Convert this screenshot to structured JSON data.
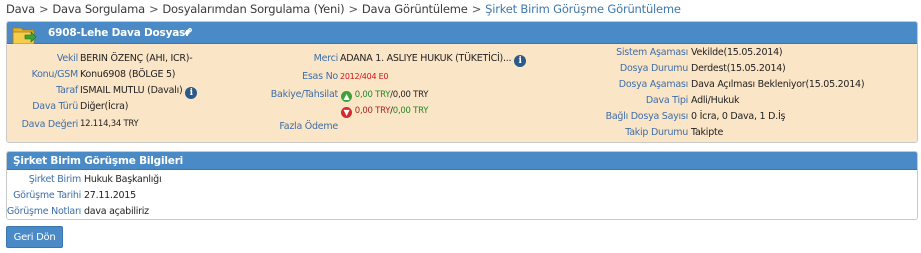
{
  "breadcrumb": {
    "items": [
      "Dava",
      "Dava Sorgulama",
      "Dosyalarımdan Sorgulama (Yeni)",
      "Dava Görüntüleme"
    ],
    "current": "Şirket Birim Görüşme Görüntüleme",
    "separator": ">"
  },
  "case_panel": {
    "title": "6908-Lehe Dava Dosyası",
    "folder_icon": "folder-arrow-icon",
    "link_icon": "link-icon",
    "fields": {
      "vekil": {
        "label": "Vekil",
        "value": "BERIN ÖZENÇ (AHI, ICR)-"
      },
      "konu_gsm": {
        "label": "Konu/GSM",
        "value": "Konu6908 (BÖLGE 5)"
      },
      "taraf": {
        "label": "Taraf",
        "value": "ISMAIL MUTLU (Davalı)"
      },
      "dava_turu": {
        "label": "Dava Türü",
        "value": "Diğer(İcra)"
      },
      "dava_degeri": {
        "label": "Dava Değeri",
        "value": "12.114,34 TRY"
      },
      "merci": {
        "label": "Merci",
        "value": "ADANA 1. ASLIYE HUKUK (TÜKETİCİ)..."
      },
      "esas_no": {
        "label": "Esas No",
        "value": "2012/404 E0"
      },
      "bakiye": {
        "label": "Bakiye/Tahsilat",
        "row1": {
          "first": "0,00 TRY",
          "second": "0,00 TRY"
        },
        "row2": {
          "first": "0,00 TRY",
          "second": "0,00 TRY"
        }
      },
      "fazla_odeme": {
        "label": "Fazla Ödeme",
        "value": ""
      },
      "sistem_asamasi": {
        "label": "Sistem Aşaması",
        "value": "Vekilde(15.05.2014)"
      },
      "dosya_durumu": {
        "label": "Dosya Durumu",
        "value": "Derdest(15.05.2014)"
      },
      "dosya_asamasi": {
        "label": "Dosya Aşaması",
        "value": "Dava Açılması Bekleniyor(15.05.2014)"
      },
      "dava_tipi": {
        "label": "Dava Tipi",
        "value": "Adli/Hukuk"
      },
      "bagli_dosya": {
        "label": "Bağlı Dosya Sayısı",
        "value": "0 İcra, 0 Dava, 1 D.İş"
      },
      "takip_durumu": {
        "label": "Takip Durumu",
        "value": "Takipte"
      }
    }
  },
  "meeting_panel": {
    "title": "Şirket Birim Görüşme Bilgileri",
    "fields": {
      "sirket_birim": {
        "label": "Şirket Birim",
        "value": "Hukuk Başkanlığı"
      },
      "gorusme_tarihi": {
        "label": "Görüşme Tarihi",
        "value": "27.11.2015"
      },
      "gorusme_notlari": {
        "label": "Görüşme Notları",
        "value": "dava açabiliriz"
      }
    }
  },
  "buttons": {
    "back": "Geri Dön"
  },
  "colors": {
    "header_blue": "#4a8ac6",
    "panel_beige": "#fbe5c7",
    "label_blue": "#3d6ea8",
    "accent_red": "#d0141a",
    "accent_green": "#1f8a26"
  }
}
